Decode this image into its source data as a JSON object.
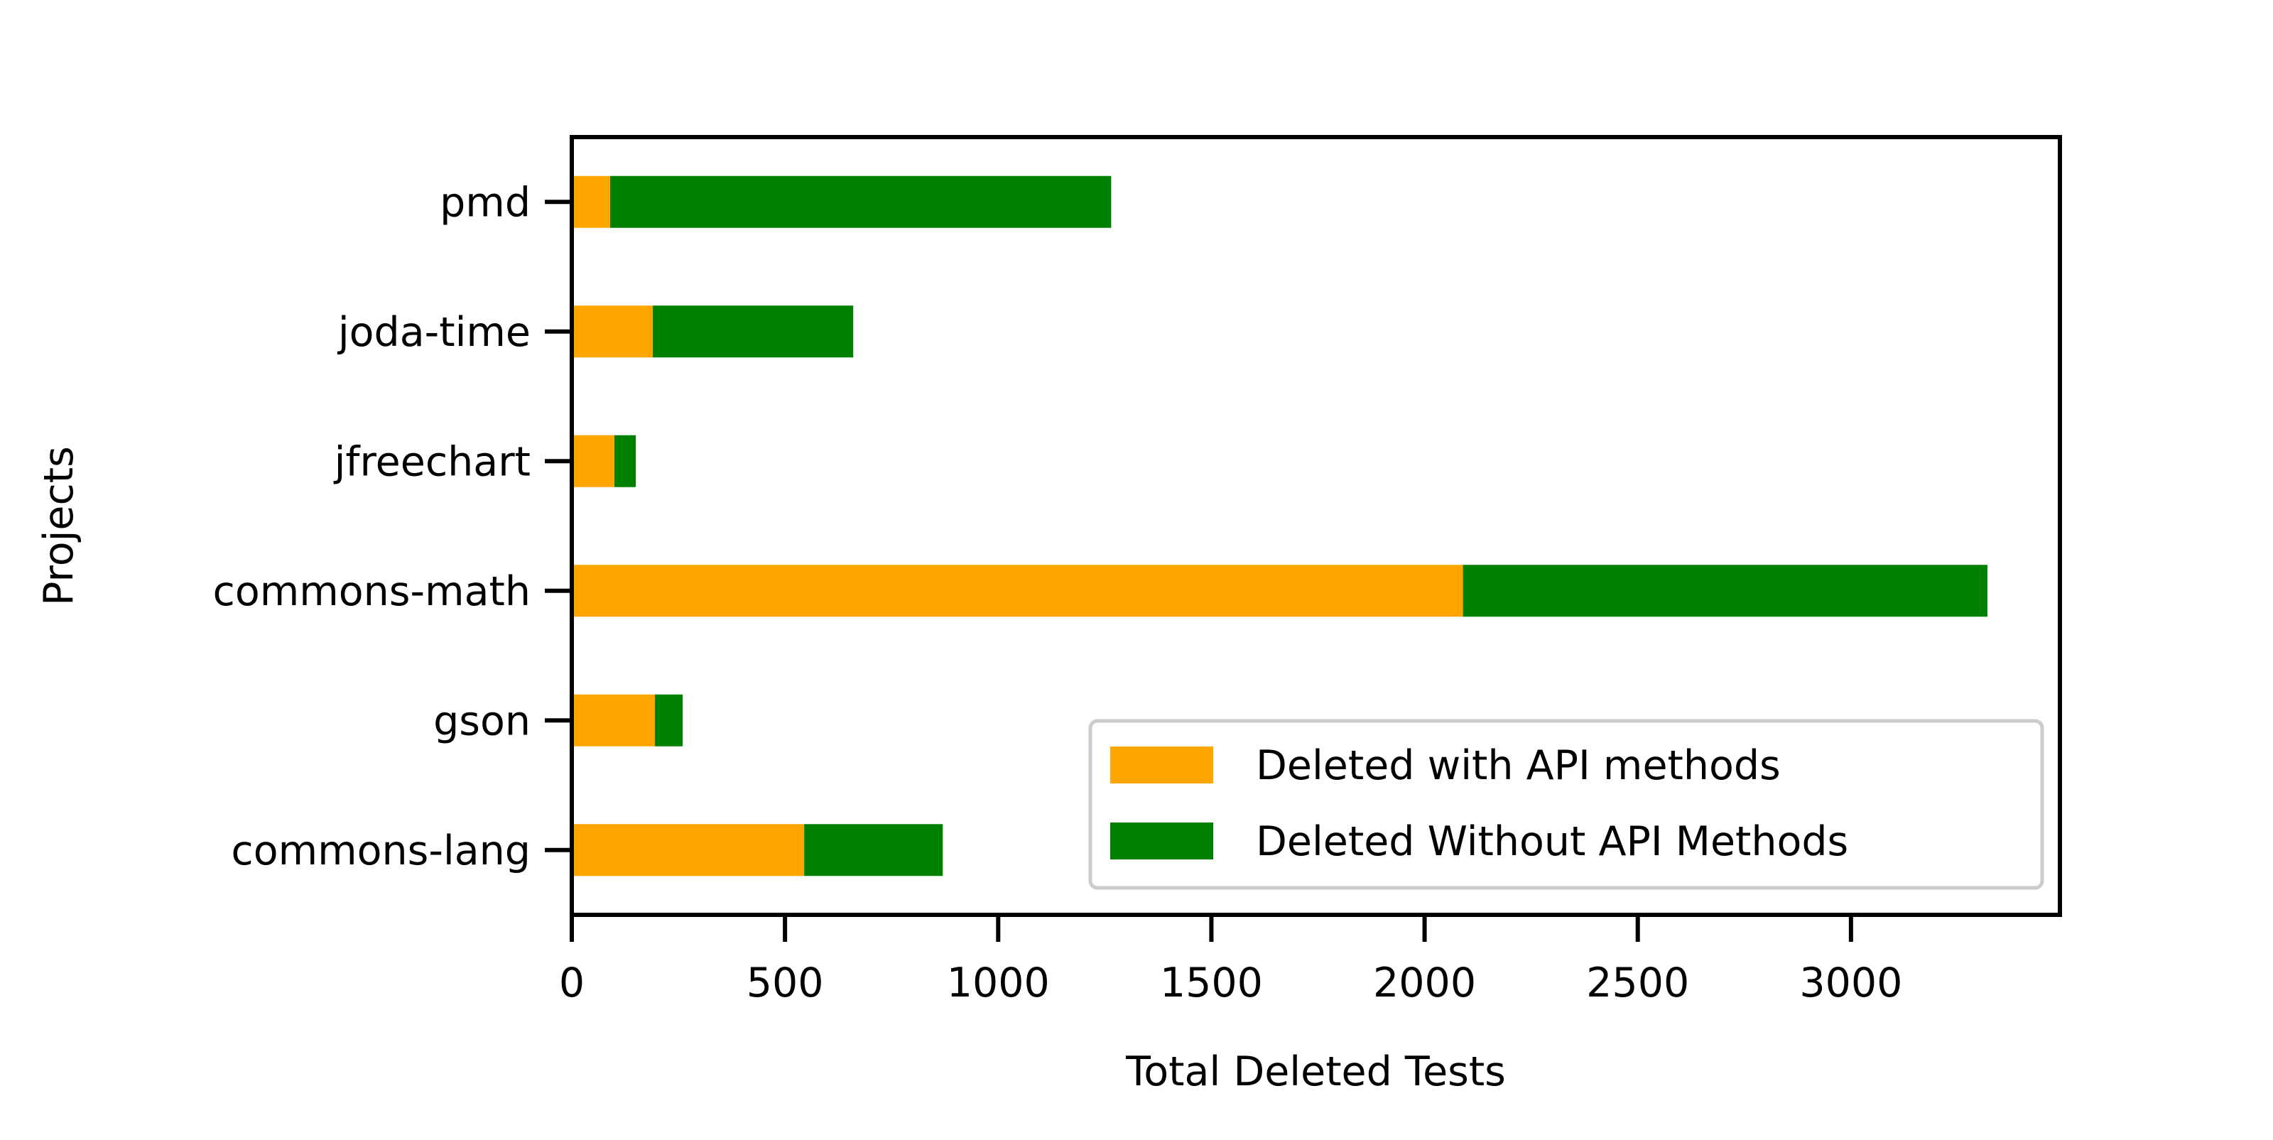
{
  "chart_data": {
    "type": "bar",
    "orientation": "horizontal",
    "stacked": true,
    "title": "",
    "xlabel": "Total Deleted Tests",
    "ylabel": "Projects",
    "categories": [
      "commons-lang",
      "gson",
      "commons-math",
      "jfreechart",
      "joda-time",
      "pmd"
    ],
    "series": [
      {
        "name": "Deleted with API methods",
        "color": "#FFA500",
        "values": [
          545,
          195,
          2090,
          100,
          190,
          90
        ]
      },
      {
        "name": "Deleted Without API Methods",
        "color": "#008000",
        "values": [
          325,
          65,
          1230,
          50,
          470,
          1175
        ]
      }
    ],
    "xlim": [
      0,
      3490
    ],
    "xticks": [
      0,
      500,
      1000,
      1500,
      2000,
      2500,
      3000
    ],
    "grid": false,
    "legend_position": "lower right"
  }
}
